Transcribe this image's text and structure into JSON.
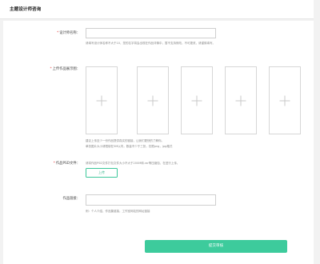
{
  "header": {
    "title": "主题设计师咨询"
  },
  "form": {
    "designer_name": {
      "label": "设计师名称：",
      "value": "",
      "hint": "请填写设计师名称不大于10，您的名字将会出现在作品详情中，暂不支持修改，不可更改，请谨慎填写。"
    },
    "showcase": {
      "label": "上传作品展示图：",
      "slots": [
        "add",
        "add",
        "add",
        "add",
        "add"
      ],
      "hint_lines": [
        "建议上传至少一份作品提供真实的链接，让我们更快的了解你。",
        "单张图片大小请限制在5M以内，数量不少于三张，仅限png，jpg格式"
      ]
    },
    "psd": {
      "label": "作品PSD文件：",
      "hint": "请将作品PSD文件打包文件大小不大于200M和.rar等压缩包，在进行上传。",
      "button_label": "上传"
    },
    "link": {
      "label": "作品链接：",
      "value": "",
      "hint": "例：个人介绍，作品集链接，工作室网站的网址链接"
    },
    "submit_label": "提交审核"
  }
}
